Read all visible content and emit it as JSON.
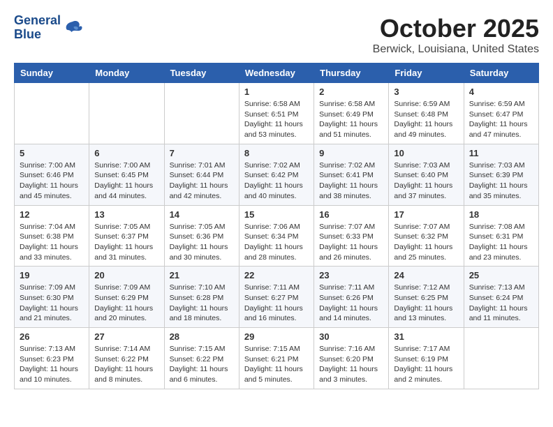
{
  "logo": {
    "line1": "General",
    "line2": "Blue"
  },
  "title": "October 2025",
  "location": "Berwick, Louisiana, United States",
  "weekdays": [
    "Sunday",
    "Monday",
    "Tuesday",
    "Wednesday",
    "Thursday",
    "Friday",
    "Saturday"
  ],
  "weeks": [
    [
      {
        "day": "",
        "content": ""
      },
      {
        "day": "",
        "content": ""
      },
      {
        "day": "",
        "content": ""
      },
      {
        "day": "1",
        "content": "Sunrise: 6:58 AM\nSunset: 6:51 PM\nDaylight: 11 hours and 53 minutes."
      },
      {
        "day": "2",
        "content": "Sunrise: 6:58 AM\nSunset: 6:49 PM\nDaylight: 11 hours and 51 minutes."
      },
      {
        "day": "3",
        "content": "Sunrise: 6:59 AM\nSunset: 6:48 PM\nDaylight: 11 hours and 49 minutes."
      },
      {
        "day": "4",
        "content": "Sunrise: 6:59 AM\nSunset: 6:47 PM\nDaylight: 11 hours and 47 minutes."
      }
    ],
    [
      {
        "day": "5",
        "content": "Sunrise: 7:00 AM\nSunset: 6:46 PM\nDaylight: 11 hours and 45 minutes."
      },
      {
        "day": "6",
        "content": "Sunrise: 7:00 AM\nSunset: 6:45 PM\nDaylight: 11 hours and 44 minutes."
      },
      {
        "day": "7",
        "content": "Sunrise: 7:01 AM\nSunset: 6:44 PM\nDaylight: 11 hours and 42 minutes."
      },
      {
        "day": "8",
        "content": "Sunrise: 7:02 AM\nSunset: 6:42 PM\nDaylight: 11 hours and 40 minutes."
      },
      {
        "day": "9",
        "content": "Sunrise: 7:02 AM\nSunset: 6:41 PM\nDaylight: 11 hours and 38 minutes."
      },
      {
        "day": "10",
        "content": "Sunrise: 7:03 AM\nSunset: 6:40 PM\nDaylight: 11 hours and 37 minutes."
      },
      {
        "day": "11",
        "content": "Sunrise: 7:03 AM\nSunset: 6:39 PM\nDaylight: 11 hours and 35 minutes."
      }
    ],
    [
      {
        "day": "12",
        "content": "Sunrise: 7:04 AM\nSunset: 6:38 PM\nDaylight: 11 hours and 33 minutes."
      },
      {
        "day": "13",
        "content": "Sunrise: 7:05 AM\nSunset: 6:37 PM\nDaylight: 11 hours and 31 minutes."
      },
      {
        "day": "14",
        "content": "Sunrise: 7:05 AM\nSunset: 6:36 PM\nDaylight: 11 hours and 30 minutes."
      },
      {
        "day": "15",
        "content": "Sunrise: 7:06 AM\nSunset: 6:34 PM\nDaylight: 11 hours and 28 minutes."
      },
      {
        "day": "16",
        "content": "Sunrise: 7:07 AM\nSunset: 6:33 PM\nDaylight: 11 hours and 26 minutes."
      },
      {
        "day": "17",
        "content": "Sunrise: 7:07 AM\nSunset: 6:32 PM\nDaylight: 11 hours and 25 minutes."
      },
      {
        "day": "18",
        "content": "Sunrise: 7:08 AM\nSunset: 6:31 PM\nDaylight: 11 hours and 23 minutes."
      }
    ],
    [
      {
        "day": "19",
        "content": "Sunrise: 7:09 AM\nSunset: 6:30 PM\nDaylight: 11 hours and 21 minutes."
      },
      {
        "day": "20",
        "content": "Sunrise: 7:09 AM\nSunset: 6:29 PM\nDaylight: 11 hours and 20 minutes."
      },
      {
        "day": "21",
        "content": "Sunrise: 7:10 AM\nSunset: 6:28 PM\nDaylight: 11 hours and 18 minutes."
      },
      {
        "day": "22",
        "content": "Sunrise: 7:11 AM\nSunset: 6:27 PM\nDaylight: 11 hours and 16 minutes."
      },
      {
        "day": "23",
        "content": "Sunrise: 7:11 AM\nSunset: 6:26 PM\nDaylight: 11 hours and 14 minutes."
      },
      {
        "day": "24",
        "content": "Sunrise: 7:12 AM\nSunset: 6:25 PM\nDaylight: 11 hours and 13 minutes."
      },
      {
        "day": "25",
        "content": "Sunrise: 7:13 AM\nSunset: 6:24 PM\nDaylight: 11 hours and 11 minutes."
      }
    ],
    [
      {
        "day": "26",
        "content": "Sunrise: 7:13 AM\nSunset: 6:23 PM\nDaylight: 11 hours and 10 minutes."
      },
      {
        "day": "27",
        "content": "Sunrise: 7:14 AM\nSunset: 6:22 PM\nDaylight: 11 hours and 8 minutes."
      },
      {
        "day": "28",
        "content": "Sunrise: 7:15 AM\nSunset: 6:22 PM\nDaylight: 11 hours and 6 minutes."
      },
      {
        "day": "29",
        "content": "Sunrise: 7:15 AM\nSunset: 6:21 PM\nDaylight: 11 hours and 5 minutes."
      },
      {
        "day": "30",
        "content": "Sunrise: 7:16 AM\nSunset: 6:20 PM\nDaylight: 11 hours and 3 minutes."
      },
      {
        "day": "31",
        "content": "Sunrise: 7:17 AM\nSunset: 6:19 PM\nDaylight: 11 hours and 2 minutes."
      },
      {
        "day": "",
        "content": ""
      }
    ]
  ]
}
